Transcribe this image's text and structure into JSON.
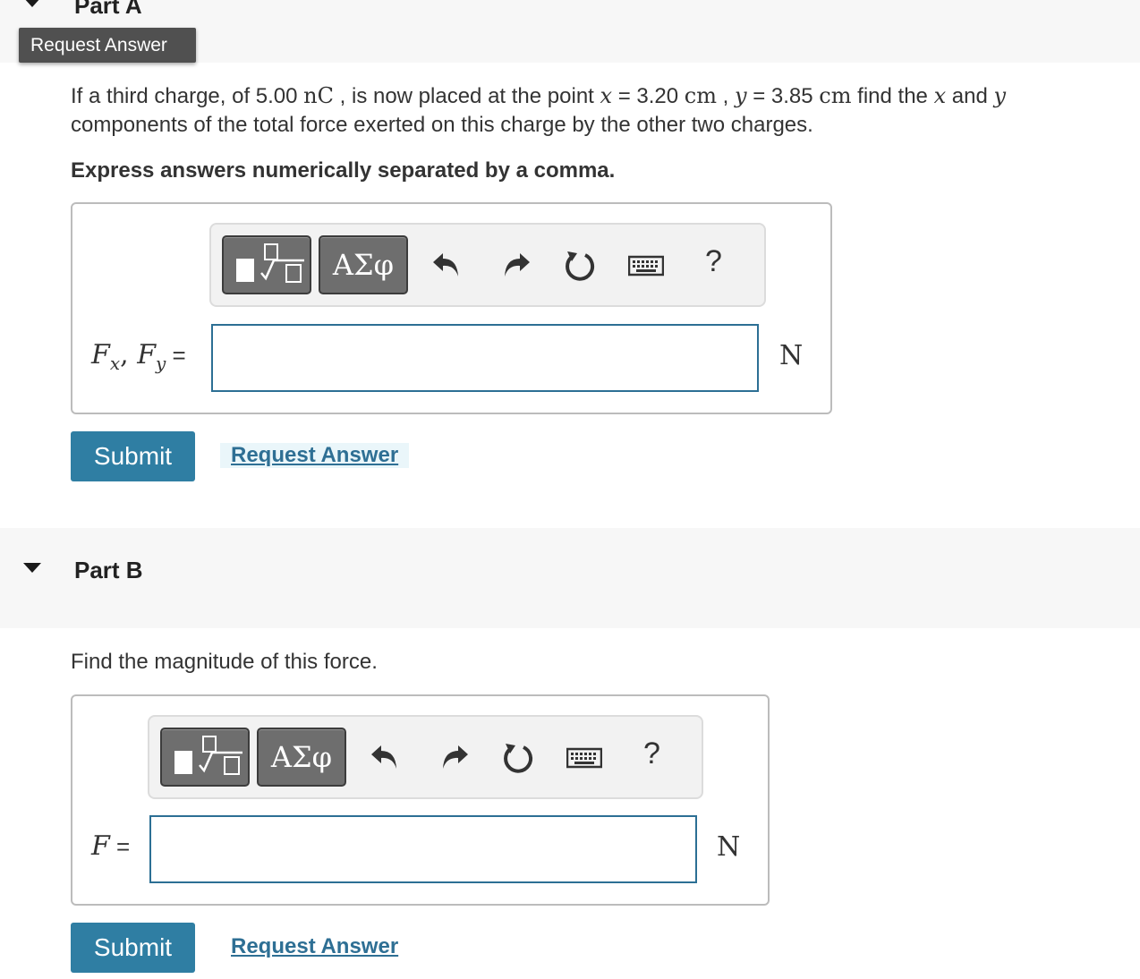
{
  "tooltip": {
    "label": "Request Answer"
  },
  "part_a": {
    "title": "Part A",
    "question": {
      "t1": "If a third charge, of 5.00 ",
      "unit_nc": "nC",
      "t2": " , is now placed at the point ",
      "x_var": "x",
      "t3": " = 3.20 ",
      "unit_cm1": "cm",
      "t4": " , ",
      "y_var": "y",
      "t5": " = 3.85 ",
      "unit_cm2": "cm",
      "t6": " find the ",
      "x_var2": "x",
      "t7": " and ",
      "y_var2": "y",
      "t8": " components of the total force exerted on this charge by the other two charges."
    },
    "instruction": "Express answers numerically separated by a comma.",
    "toolbar": {
      "greek_label": "ΑΣφ",
      "help_label": "?"
    },
    "label": {
      "f1": "F",
      "sub1": "x",
      "comma": ", ",
      "f2": "F",
      "sub2": "y",
      "eq": " ="
    },
    "input_value": "",
    "unit": "N",
    "submit_label": "Submit",
    "request_label": "Request Answer"
  },
  "part_b": {
    "title": "Part B",
    "question": "Find the magnitude of this force.",
    "toolbar": {
      "greek_label": "ΑΣφ",
      "help_label": "?"
    },
    "label": {
      "f": "F",
      "eq": " ="
    },
    "input_value": "",
    "unit": "N",
    "submit_label": "Submit",
    "request_label": "Request Answer"
  },
  "colors": {
    "submit_bg": "#2f7ea3",
    "link": "#2e6f94",
    "input_border": "#2c6f94",
    "band_bg": "#f7f7f7",
    "tooltip_bg": "#505050"
  }
}
